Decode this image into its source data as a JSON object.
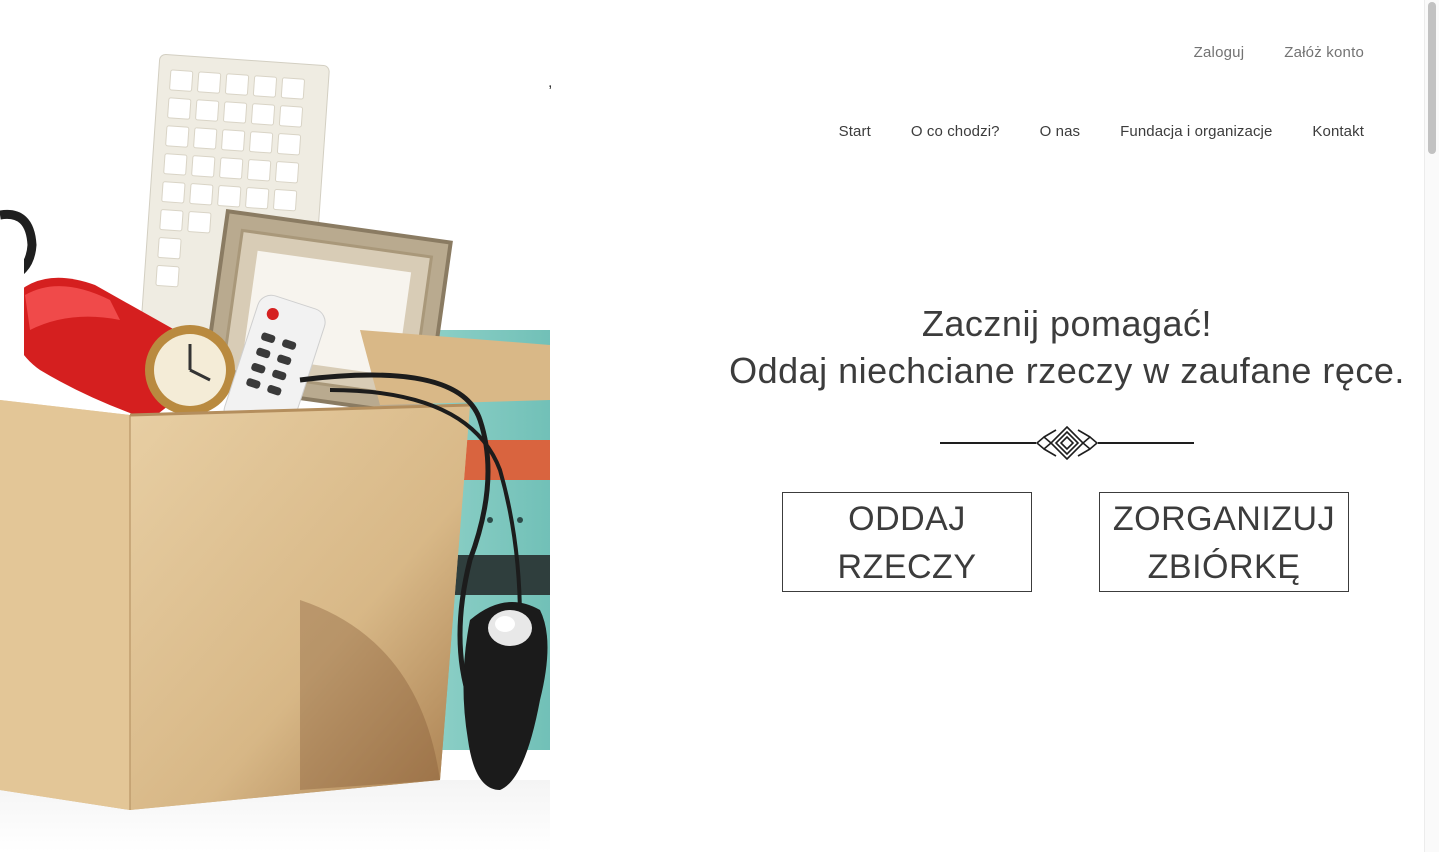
{
  "header": {
    "auth": {
      "login": "Zaloguj",
      "register": "Załóż konto"
    },
    "nav": [
      {
        "label": "Start"
      },
      {
        "label": "O co chodzi?"
      },
      {
        "label": "O nas"
      },
      {
        "label": "Fundacja i organizacje"
      },
      {
        "label": "Kontakt"
      }
    ]
  },
  "hero": {
    "stray_mark": ",",
    "headline_line1": "Zacznij pomagać!",
    "headline_line2": "Oddaj niechciane rzeczy w zaufane ręce.",
    "decoration_icon": "ornament-divider-icon",
    "buttons": {
      "give": "ODDAJ RZECZY",
      "organize": "ZORGANIZUJ ZBIÓRKĘ"
    }
  },
  "colors": {
    "text": "#3c3c3c",
    "muted": "#737373",
    "border": "#3c3c3c",
    "background": "#ffffff"
  }
}
